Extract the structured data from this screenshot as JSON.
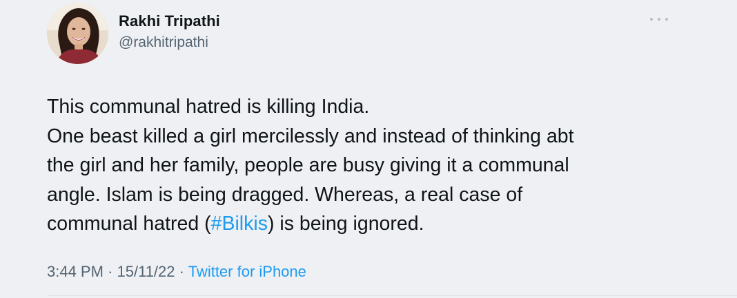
{
  "author": {
    "name": "Rakhi Tripathi",
    "handle": "@rakhitripathi",
    "avatar_icon": "profile-photo"
  },
  "more_icon": "ellipsis-icon",
  "tweet": {
    "line1": "This communal hatred is killing India.",
    "line2": "One beast killed a girl mercilessly and instead of thinking abt",
    "line3": "the girl and her family, people are busy giving it a communal",
    "line4": "angle. Islam is being dragged. Whereas, a real case of",
    "line5_before": "communal hatred (",
    "line5_hashtag": "#Bilkis",
    "line5_after": ") is being ignored."
  },
  "meta": {
    "time": "3:44 PM",
    "separator": "·",
    "date": "15/11/22",
    "source": "Twitter for iPhone"
  },
  "colors": {
    "background": "#eff0f3",
    "text": "#0f1419",
    "secondary": "#536471",
    "link": "#1d9bf0"
  }
}
